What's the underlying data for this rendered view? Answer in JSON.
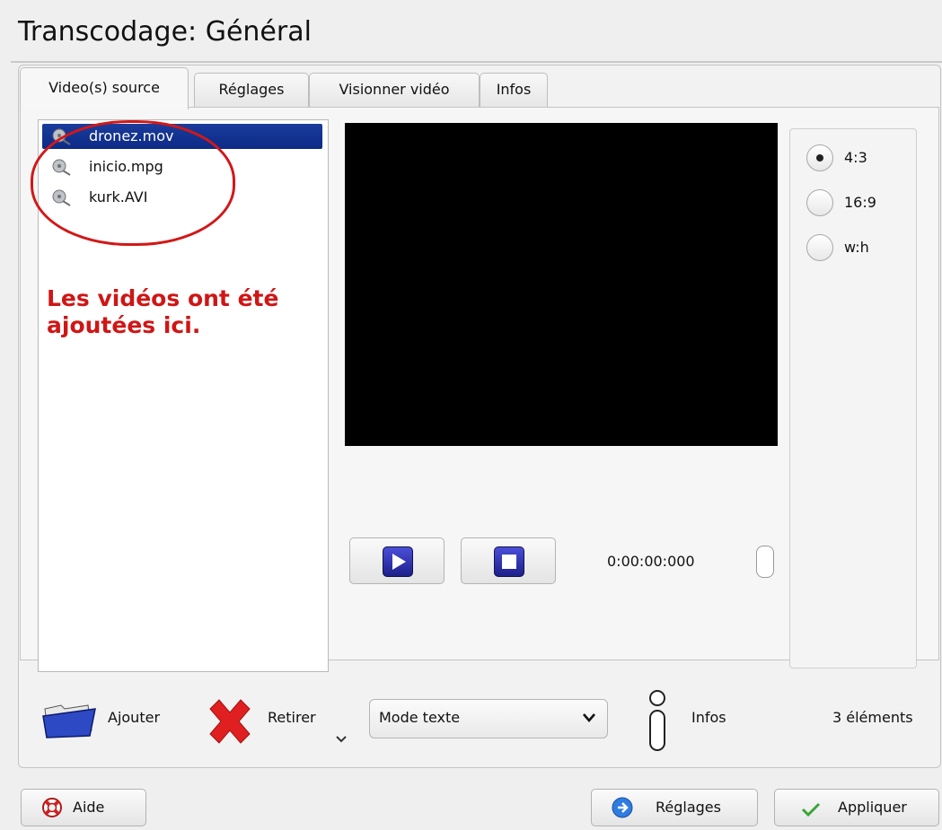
{
  "window": {
    "title": "Transcodage: Général"
  },
  "tabs": [
    {
      "label": "Video(s) source",
      "active": true
    },
    {
      "label": "Réglages",
      "active": false
    },
    {
      "label": "Visionner vidéo",
      "active": false
    },
    {
      "label": "Infos",
      "active": false
    }
  ],
  "files": [
    {
      "name": "dronez.mov",
      "selected": true,
      "icon": "film-reel-icon"
    },
    {
      "name": "inicio.mpg",
      "selected": false,
      "icon": "film-reel-icon"
    },
    {
      "name": "kurk.AVI",
      "selected": false,
      "icon": "film-reel-icon"
    }
  ],
  "annotation": {
    "line1": "Les vidéos ont été",
    "line2": "ajoutées ici."
  },
  "player": {
    "timecode": "0:00:00:000"
  },
  "aspect_ratio": {
    "options": [
      {
        "label": "4:3",
        "selected": true
      },
      {
        "label": "16:9",
        "selected": false
      },
      {
        "label": "w:h",
        "selected": false
      }
    ]
  },
  "toolbar": {
    "add_label": "Ajouter",
    "remove_label": "Retirer",
    "mode_select_value": "Mode texte",
    "infos_label": "Infos",
    "count_label": "3 éléments"
  },
  "footer": {
    "help_label": "Aide",
    "settings_label": "Réglages",
    "apply_label": "Appliquer"
  },
  "colors": {
    "selection": "#0d2a86",
    "annotation": "#cf1616",
    "apply_check": "#3aa63a"
  }
}
